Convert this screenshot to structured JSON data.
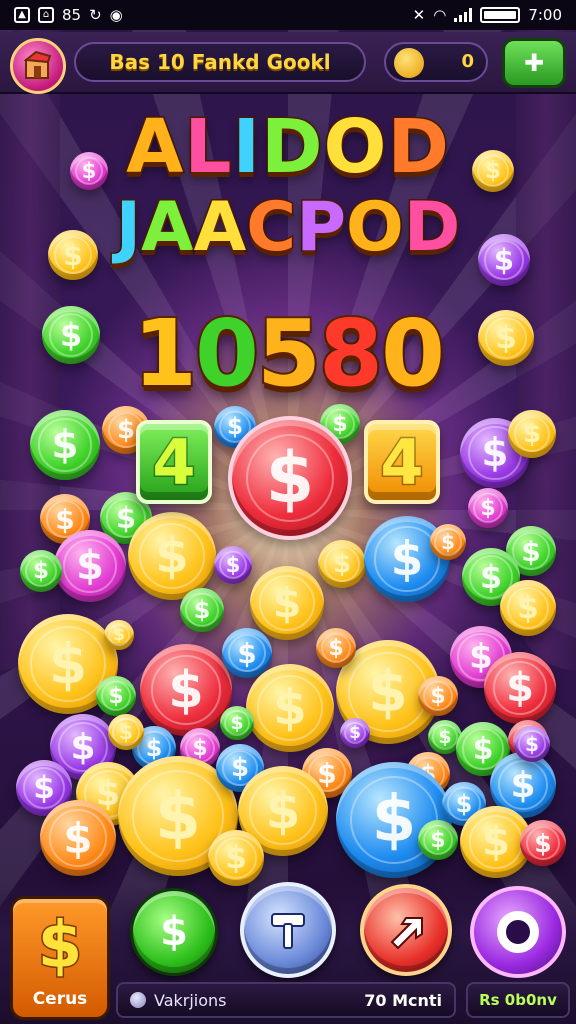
{
  "status_bar": {
    "left_text": "85",
    "time": "7:00"
  },
  "header": {
    "title": "Bas 10 Fankd Gookl",
    "coin_balance": "0"
  },
  "headline": {
    "line1": "ALIDOD",
    "line2": "JAACPOD",
    "amount": "10580"
  },
  "tiles": {
    "left_value": "4",
    "right_value": "4"
  },
  "coin_symbol": "$",
  "bottom_bar": {
    "cash_label": "Cerus",
    "info_left": "Vakrjions",
    "info_right": "70 Mcnti",
    "bonus_label": "Rs 0b0nv"
  },
  "colors": {
    "gold": "#ffc21a",
    "green": "#3fd22a",
    "pink": "#e23bd0",
    "red": "#ee2d3c",
    "blue": "#1e8cf0",
    "orange": "#ff8a1a",
    "purple": "#9a3ae6"
  }
}
